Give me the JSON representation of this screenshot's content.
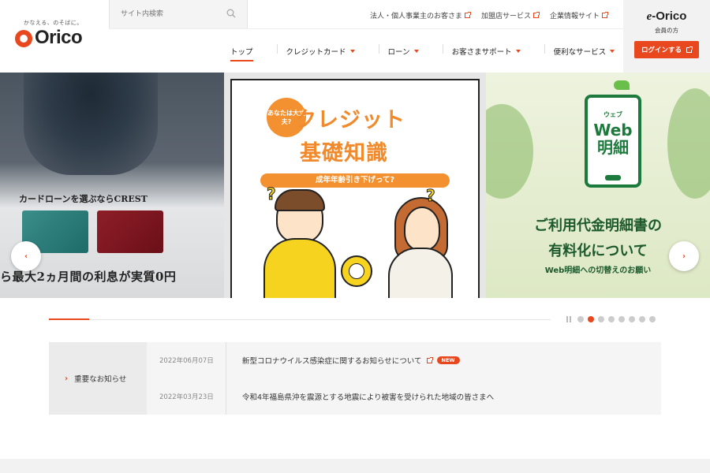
{
  "brand": {
    "tagline": "かなえる、のそばに。",
    "logo": "Orico"
  },
  "search": {
    "placeholder": "サイト内検索"
  },
  "util_links": [
    "法人・個人事業主のお客さま",
    "加盟店サービス",
    "企業情報サイト"
  ],
  "nav": {
    "items": [
      {
        "label": "トップ"
      },
      {
        "label": "クレジットカード"
      },
      {
        "label": "ローン"
      },
      {
        "label": "お客さまサポート"
      },
      {
        "label": "便利なサービス"
      }
    ]
  },
  "member": {
    "service_prefix": "e",
    "service_name": "-Orico",
    "label": "会員の方",
    "login_label": "ログインする"
  },
  "carousel": {
    "slide_left": {
      "line1": "カードローンを選ぶならCREST",
      "line2": "ら最大2ヵ月間の利息が実質0円"
    },
    "slide_center": {
      "badge": "あなたは大丈夫?",
      "title1": "クレジット",
      "title2": "基礎知識",
      "question": "成年年齢引き下げって?"
    },
    "slide_right": {
      "phone_sub": "ウェブ",
      "phone_main1": "Web",
      "phone_main2": "明細",
      "line1": "ご利用代金明細書の",
      "line2": "有料化について",
      "line3": "Web明細への切替えのお願い"
    },
    "prev_label": "‹",
    "next_label": "›",
    "dot_count": 8,
    "active_dot": 1,
    "progress": 0.08
  },
  "notices": {
    "label": "重要なお知らせ",
    "items": [
      {
        "date": "2022年06月07日",
        "title": "新型コロナウイルス感染症に関するお知らせについて",
        "badge": "NEW"
      },
      {
        "date": "2022年03月23日",
        "title": "令和4年福島県沖を震源とする地震により被害を受けられた地域の皆さまへ"
      }
    ]
  },
  "colors": {
    "accent": "#e9471e",
    "web_green": "#1c7a3c",
    "orange": "#f08a2c"
  }
}
